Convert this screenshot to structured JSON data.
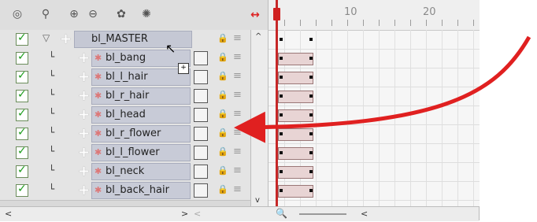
{
  "toolbar": {
    "buttons": [
      {
        "icon": "binoculars-icon"
      },
      {
        "icon": "magnet-icon"
      },
      {
        "icon": "add-layer-icon"
      },
      {
        "icon": "remove-layer-icon"
      },
      {
        "icon": "color-icon"
      },
      {
        "icon": "color-reset-icon"
      }
    ],
    "right_icon": "expand-collapse-icon"
  },
  "layers": [
    {
      "name": "bl_MASTER",
      "kind": "group"
    },
    {
      "name": "bl_bang",
      "kind": "drawing"
    },
    {
      "name": "bl_l_hair",
      "kind": "drawing"
    },
    {
      "name": "bl_r_hair",
      "kind": "drawing"
    },
    {
      "name": "bl_head",
      "kind": "drawing"
    },
    {
      "name": "bl_r_flower",
      "kind": "drawing"
    },
    {
      "name": "bl_l_flower",
      "kind": "drawing"
    },
    {
      "name": "bl_neck",
      "kind": "drawing"
    },
    {
      "name": "bl_back_hair",
      "kind": "drawing"
    }
  ],
  "ruler": {
    "labels": [
      "10",
      "20"
    ]
  },
  "annotation": {
    "color": "#e02020",
    "icon": "red-arrow"
  },
  "scroll": {
    "left_label": "<",
    "right_label": ">",
    "up_label": "^",
    "down_label": "v",
    "tl_left_label": "<"
  }
}
